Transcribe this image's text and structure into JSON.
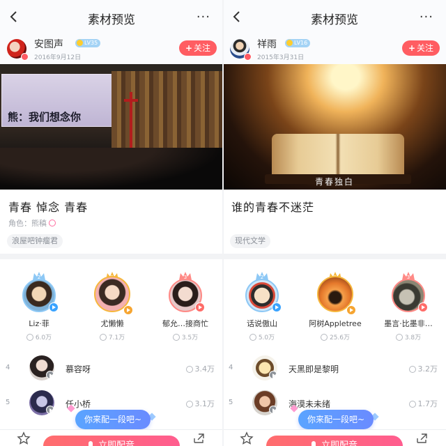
{
  "panels": [
    {
      "header": {
        "title": "素材预览",
        "more": "···"
      },
      "author": {
        "name": "安图声",
        "level": "LV35",
        "date": "2016年9月12日",
        "follow_label": "关注"
      },
      "video": {
        "caption": "",
        "screen_text": "熊：我们想念你"
      },
      "material": {
        "title": "青春 悼念 青春",
        "role": "角色：熊稹",
        "tag": "浪屋吧钟瘤君"
      },
      "top3": [
        {
          "rank": 2,
          "name": "Liz·菲",
          "count": "6.0万"
        },
        {
          "rank": 1,
          "name": "尤懒懒",
          "count": "7.1万"
        },
        {
          "rank": 3,
          "name": "郁允…接商忙",
          "count": "3.5万"
        }
      ],
      "list": [
        {
          "rank": "4",
          "name": "慕容呀",
          "count": "3.4万"
        },
        {
          "rank": "5",
          "name": "任小桥",
          "count": "3.1万"
        }
      ],
      "cta": {
        "bubble": "你来配一段吧~",
        "record_label": "立即配音"
      }
    },
    {
      "header": {
        "title": "素材预览",
        "more": "···"
      },
      "author": {
        "name": "祥雨",
        "level": "LV16",
        "date": "2015年3月31日",
        "follow_label": "关注"
      },
      "video": {
        "caption": "青春独白",
        "screen_text": ""
      },
      "material": {
        "title": "谁的青春不迷茫",
        "role": "",
        "tag": "现代文学"
      },
      "top3": [
        {
          "rank": 2,
          "name": "话说傲山",
          "count": "5.0万"
        },
        {
          "rank": 1,
          "name": "阿树Appletree",
          "count": "25.6万"
        },
        {
          "rank": 3,
          "name": "墨言·比墨非…",
          "count": "3.8万"
        }
      ],
      "list": [
        {
          "rank": "4",
          "name": "天黑即是黎明",
          "count": "3.2万"
        },
        {
          "rank": "5",
          "name": "海漠未未绪",
          "count": "1.7万"
        }
      ],
      "cta": {
        "bubble": "你来配一段吧~",
        "record_label": "立即配音"
      }
    }
  ],
  "colors": {
    "accent": "#ff5d62",
    "level_badge": "#a4d3f5",
    "bubble": "#5aa4ff",
    "crown_gold": "#f6b73c",
    "crown_blue": "#8dc8f5",
    "crown_red": "#ff8a86"
  },
  "icons": {
    "back": "back-arrow-icon",
    "more": "more-dots-icon",
    "play": "play-icon",
    "crown": "crown-icon",
    "star": "star-icon",
    "share": "share-icon",
    "mic": "mic-icon"
  }
}
